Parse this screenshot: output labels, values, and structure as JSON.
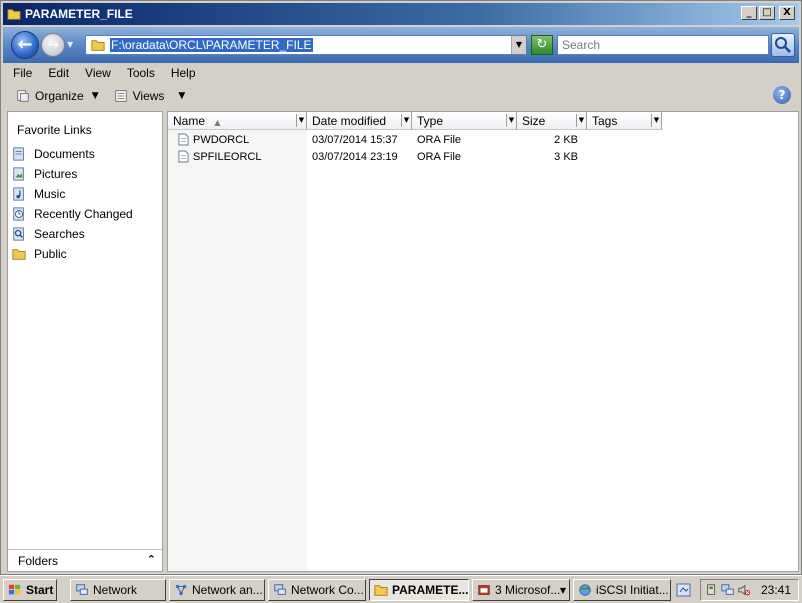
{
  "window": {
    "title": "PARAMETER_FILE",
    "controls": {
      "minimize": "_",
      "maximize": "□",
      "close": "X"
    }
  },
  "nav": {
    "address": "F:\\oradata\\ORCL\\PARAMETER_FILE",
    "search_placeholder": "Search"
  },
  "menu": [
    "File",
    "Edit",
    "View",
    "Tools",
    "Help"
  ],
  "toolbar": {
    "organize": "Organize",
    "views": "Views"
  },
  "sidebar": {
    "title": "Favorite Links",
    "items": [
      {
        "label": "Documents",
        "icon": "documents-icon"
      },
      {
        "label": "Pictures",
        "icon": "pictures-icon"
      },
      {
        "label": "Music",
        "icon": "music-icon"
      },
      {
        "label": "Recently Changed",
        "icon": "recent-icon"
      },
      {
        "label": "Searches",
        "icon": "searches-icon"
      },
      {
        "label": "Public",
        "icon": "folder-icon"
      }
    ],
    "folders_label": "Folders"
  },
  "columns": [
    "Name",
    "Date modified",
    "Type",
    "Size",
    "Tags"
  ],
  "files": [
    {
      "name": "PWDORCL",
      "date": "03/07/2014 15:37",
      "type": "ORA File",
      "size": "2 KB",
      "tags": ""
    },
    {
      "name": "SPFILEORCL",
      "date": "03/07/2014 23:19",
      "type": "ORA File",
      "size": "3 KB",
      "tags": ""
    }
  ],
  "taskbar": {
    "start": "Start",
    "tasks": [
      {
        "label": "Network"
      },
      {
        "label": "Network an..."
      },
      {
        "label": "Network Co..."
      },
      {
        "label": "PARAMETE..."
      },
      {
        "label": "3 Microsof..."
      },
      {
        "label": "iSCSI Initiat..."
      }
    ],
    "clock": "23:41"
  },
  "colors": {
    "titlebar_start": "#0a246a",
    "selection": "#316ac5",
    "nav_band": "#5a87c5"
  }
}
